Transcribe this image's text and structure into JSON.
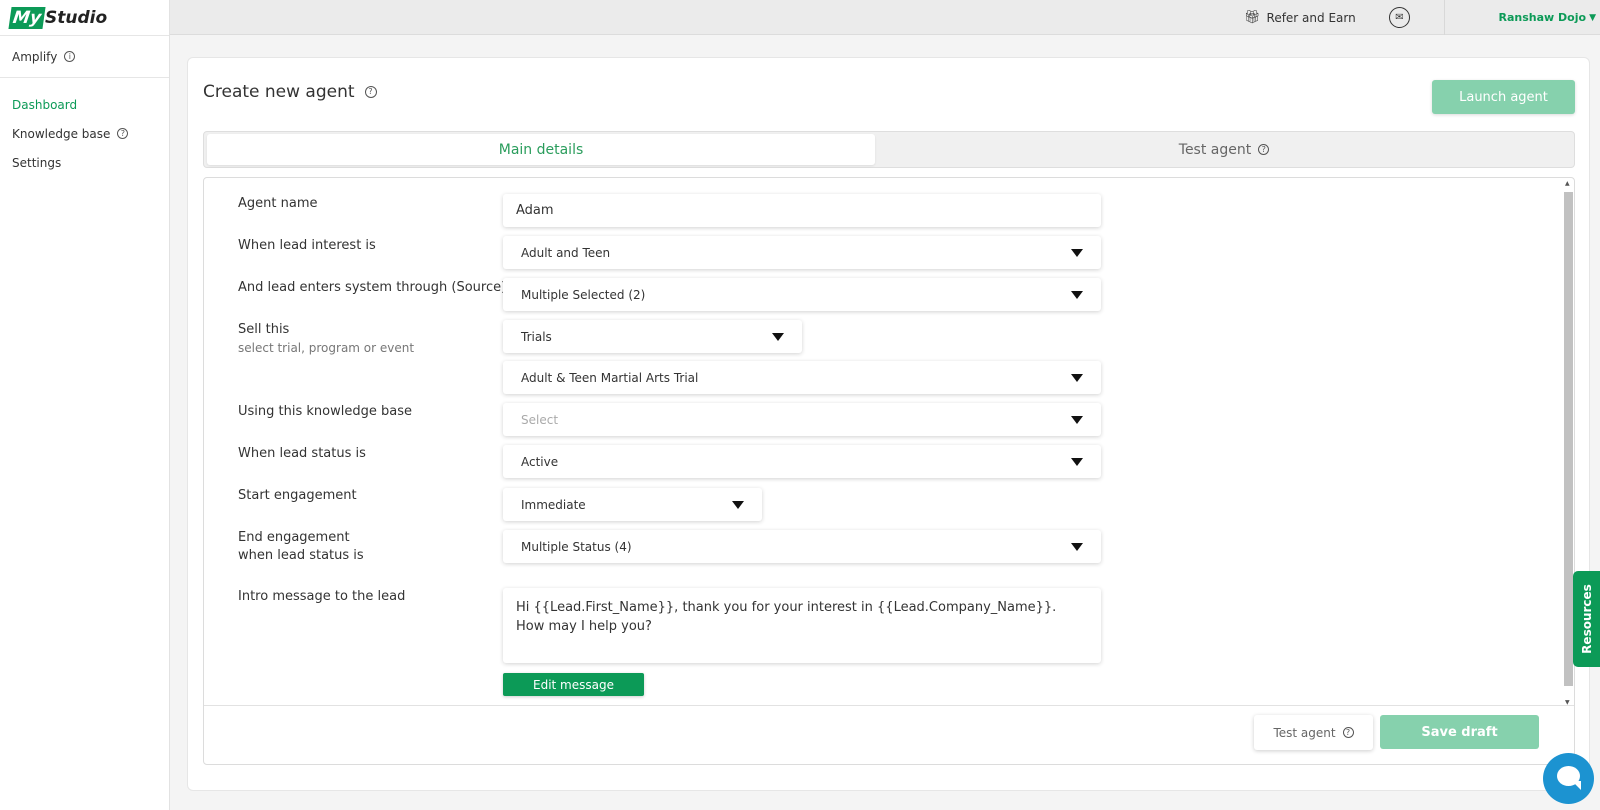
{
  "app": {
    "logo_prefix": "My",
    "logo_suffix": "Studio"
  },
  "sidebar": {
    "section_title": "Amplify",
    "items": [
      {
        "label": "Dashboard",
        "active": true
      },
      {
        "label": "Knowledge base",
        "has_info": true
      },
      {
        "label": "Settings"
      }
    ]
  },
  "topbar": {
    "refer_label": "Refer and Earn",
    "user_name": "Ranshaw Dojo",
    "icons": [
      "gift-icon",
      "mail-icon",
      "caret-down-icon"
    ]
  },
  "page": {
    "title": "Create new agent",
    "launch_label": "Launch agent"
  },
  "tabs": [
    {
      "label": "Main details",
      "active": true
    },
    {
      "label": "Test agent"
    }
  ],
  "form": {
    "agent_name": {
      "label": "Agent name",
      "value": "Adam"
    },
    "lead_interest": {
      "label": "When lead interest is",
      "value": "Adult and Teen"
    },
    "lead_source": {
      "label": "And lead enters system through (Source)",
      "value": "Multiple Selected (2)"
    },
    "sell_this": {
      "label": "Sell this",
      "sublabel": "select trial, program or event",
      "type_value": "Trials",
      "item_value": "Adult & Teen Martial Arts Trial"
    },
    "knowledge_base": {
      "label": "Using this knowledge base",
      "placeholder": "Select"
    },
    "lead_status": {
      "label": "When lead status is",
      "value": "Active"
    },
    "start_engagement": {
      "label": "Start engagement",
      "value": "Immediate"
    },
    "end_engagement": {
      "label_line1": "End engagement",
      "label_line2": "when lead status is",
      "value": "Multiple Status (4)"
    },
    "intro_message": {
      "label": "Intro message to the lead",
      "value": "Hi {{Lead.First_Name}}, thank you for your interest in {{Lead.Company_Name}}. How may I help you?"
    },
    "edit_message_label": "Edit message"
  },
  "footer": {
    "test_label": "Test agent",
    "save_label": "Save draft"
  },
  "resources_label": "Resources",
  "colors": {
    "brand_green": "#0c9a57",
    "light_green_button": "#86d1ad",
    "chat_blue": "#1c93d1"
  }
}
